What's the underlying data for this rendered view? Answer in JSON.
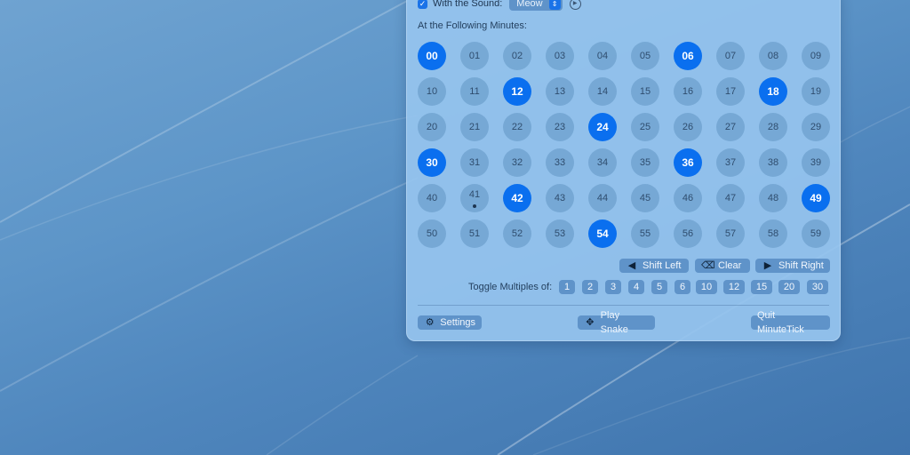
{
  "sound": {
    "checkbox_label": "With the Sound:",
    "checked": true,
    "selected_sound": "Meow"
  },
  "minutes": {
    "label": "At the Following Minutes:",
    "values": [
      "00",
      "01",
      "02",
      "03",
      "04",
      "05",
      "06",
      "07",
      "08",
      "09",
      "10",
      "11",
      "12",
      "13",
      "14",
      "15",
      "16",
      "17",
      "18",
      "19",
      "20",
      "21",
      "22",
      "23",
      "24",
      "25",
      "26",
      "27",
      "28",
      "29",
      "30",
      "31",
      "32",
      "33",
      "34",
      "35",
      "36",
      "37",
      "38",
      "39",
      "40",
      "41",
      "42",
      "43",
      "44",
      "45",
      "46",
      "47",
      "48",
      "49",
      "50",
      "51",
      "52",
      "53",
      "54",
      "55",
      "56",
      "57",
      "58",
      "59"
    ],
    "selected": [
      "00",
      "06",
      "12",
      "18",
      "24",
      "30",
      "36",
      "42",
      "49",
      "54"
    ],
    "current_marker": "41"
  },
  "actions": {
    "shift_left": "Shift Left",
    "clear": "Clear",
    "shift_right": "Shift Right"
  },
  "toggle": {
    "label": "Toggle Multiples of:",
    "values": [
      "1",
      "2",
      "3",
      "4",
      "5",
      "6",
      "10",
      "12",
      "15",
      "20",
      "30"
    ]
  },
  "footer": {
    "settings": "Settings",
    "play_snake": "Play Snake",
    "quit": "Quit MinuteTick"
  },
  "colors": {
    "selected": "#0a6fef",
    "panel": "#96c4ee",
    "button": "#5f93c9"
  }
}
